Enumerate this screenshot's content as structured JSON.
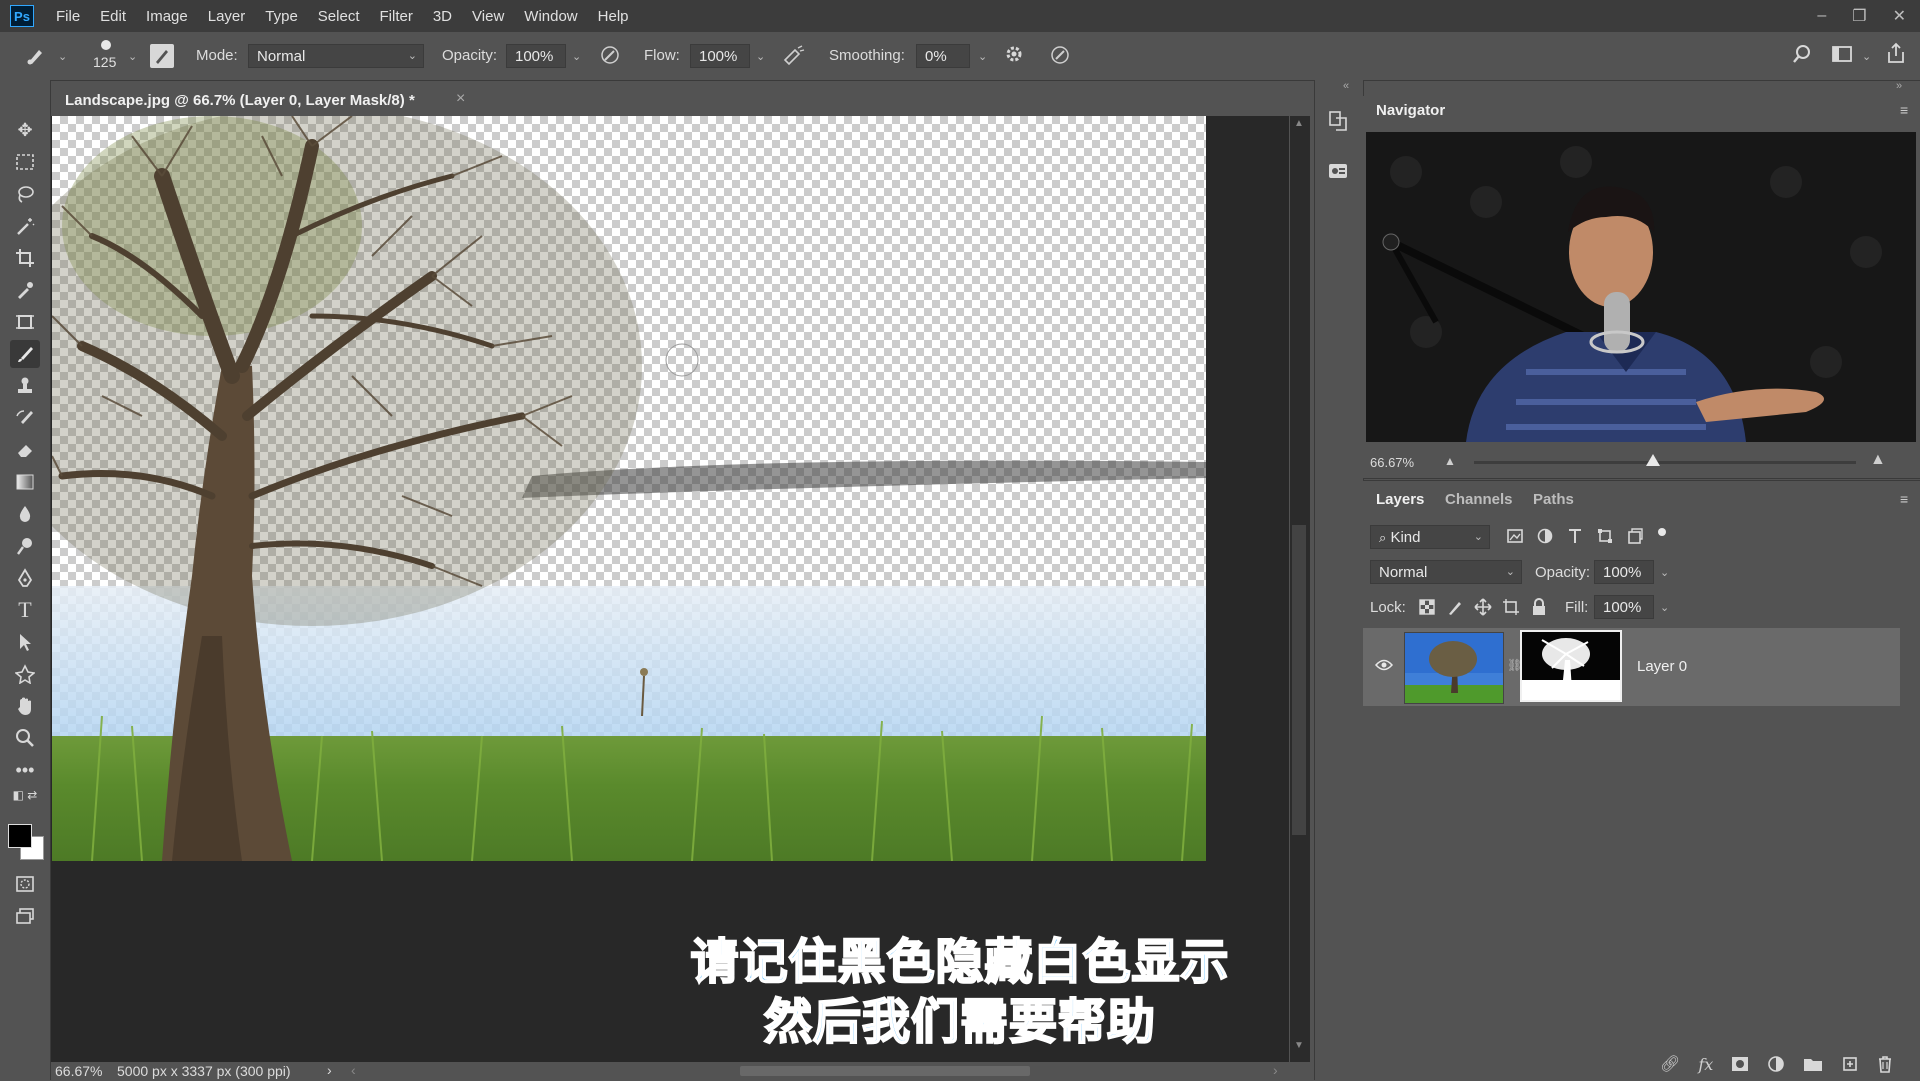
{
  "app": {
    "logo": "Ps"
  },
  "menu": [
    "File",
    "Edit",
    "Image",
    "Layer",
    "Type",
    "Select",
    "Filter",
    "3D",
    "View",
    "Window",
    "Help"
  ],
  "window_controls": {
    "minimize": "–",
    "restore": "❐",
    "close": "✕"
  },
  "options": {
    "brush_size": "125",
    "mode_label": "Mode:",
    "mode_value": "Normal",
    "opacity_label": "Opacity:",
    "opacity_value": "100%",
    "flow_label": "Flow:",
    "flow_value": "100%",
    "smoothing_label": "Smoothing:",
    "smoothing_value": "0%"
  },
  "document": {
    "tab_title": "Landscape.jpg @ 66.7% (Layer 0, Layer Mask/8) *",
    "tab_close": "×"
  },
  "status": {
    "zoom": "66.67%",
    "info": "5000 px x 3337 px (300 ppi)",
    "arrow": "›"
  },
  "subtitles": {
    "line1": "请记住黑色隐藏白色显示",
    "line2": "然后我们需要帮助"
  },
  "navigator": {
    "title": "Navigator",
    "zoom": "66.67%"
  },
  "layers_panel": {
    "tabs": [
      "Layers",
      "Channels",
      "Paths"
    ],
    "filter_kind": "Kind",
    "blend_mode": "Normal",
    "opacity_label": "Opacity:",
    "opacity_value": "100%",
    "lock_label": "Lock:",
    "fill_label": "Fill:",
    "fill_value": "100%",
    "layers": [
      {
        "name": "Layer 0",
        "visible": true
      }
    ]
  },
  "colors": {
    "accent_blue": "#31a8ff",
    "subtitle_blue": "#48b4ff",
    "panel_bg": "#535353",
    "canvas_bg": "#282828"
  }
}
